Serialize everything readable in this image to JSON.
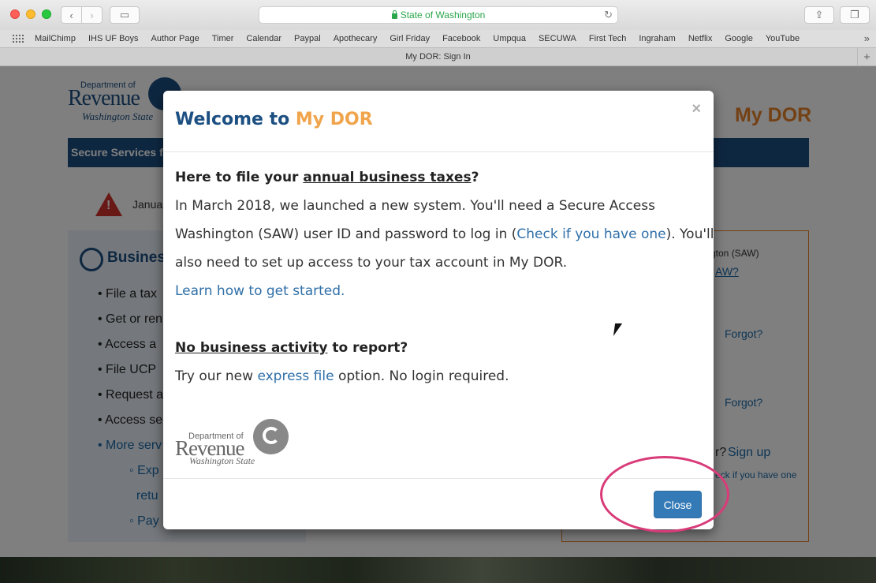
{
  "browser": {
    "url_text": "State of Washington",
    "tab_title": "My DOR: Sign In",
    "bookmarks": [
      "MailChimp",
      "IHS UF Boys",
      "Author Page",
      "Timer",
      "Calendar",
      "Paypal",
      "Apothecary",
      "Girl Friday",
      "Facebook",
      "Umpqua",
      "SECUWA",
      "First Tech",
      "Ingraham",
      "Netflix",
      "Google",
      "YouTube"
    ]
  },
  "page": {
    "logo": {
      "dept": "Department of",
      "revenue": "Revenue",
      "state": "Washington State"
    },
    "brand": "My DOR",
    "bluebar": "Secure Services f",
    "alert_text": "Januar",
    "left_panel": {
      "title": "Busines",
      "items": [
        "File a tax",
        "Get or ren",
        "Access a",
        "File UCP",
        "Request a",
        "Access se"
      ],
      "more_link": "More serv",
      "subitems": [
        "Exp",
        "retu",
        "Pay"
      ]
    },
    "right_panel": {
      "saw_text": "gton (SAW)",
      "saw_link": "AW?",
      "forgot_1": "Forgot?",
      "forgot_2": "Forgot?",
      "signup_prefix": "r?",
      "signup": "Sign up",
      "check_text": "eck if you have one"
    }
  },
  "modal": {
    "title_prefix": "Welcome to",
    "title_accent": "My DOR",
    "close_x": "×",
    "section1": {
      "heading_link": "annual business taxes",
      "heading_prefix": "Here to file your",
      "heading_suffix": "?",
      "line1": "In March 2018, we launched a new system. You'll need a Secure Access",
      "line2_prefix": "Washington (SAW) user ID and password to log in (",
      "line2_link": "Check if you have one",
      "line2_suffix": "). You'll",
      "line3": "also need to set up access to your tax account in My DOR.",
      "learn_link": "Learn how to get started."
    },
    "section2": {
      "heading_underlined": "No business activity",
      "heading_suffix": " to report?",
      "text_prefix": "Try our new ",
      "text_link": "express file",
      "text_suffix": " option. No login required."
    },
    "logo": {
      "dept": "Department of",
      "revenue": "Revenue",
      "state": "Washington State"
    },
    "close_button": "Close"
  }
}
